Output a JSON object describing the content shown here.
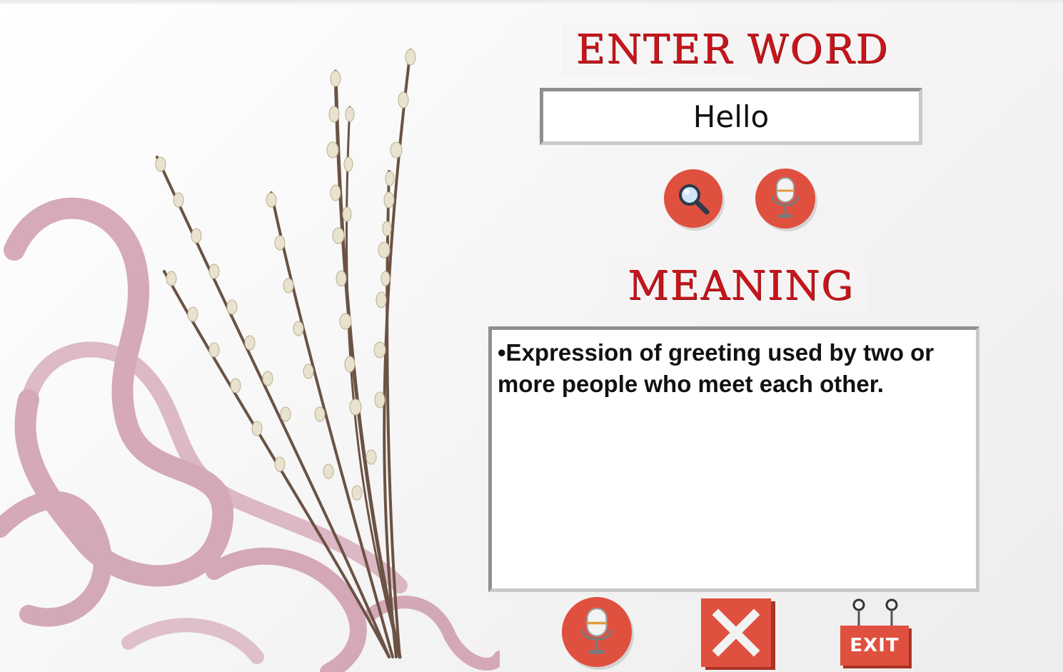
{
  "headings": {
    "enter_word": "ENTER WORD",
    "meaning": "MEANING"
  },
  "word_input": {
    "value": "Hello"
  },
  "meaning": {
    "text": "•Expression of greeting used by two or more people who meet each other."
  },
  "buttons": {
    "exit_label": "EXIT"
  },
  "icons": {
    "search": "search-icon",
    "microphone": "microphone-icon",
    "close": "close-icon",
    "exit": "exit-sign-icon"
  },
  "colors": {
    "accent": "#e0503f",
    "title_red": "#c4161c",
    "ribbon_pink": "#c98fa2",
    "branch_brown": "#6b5244"
  }
}
